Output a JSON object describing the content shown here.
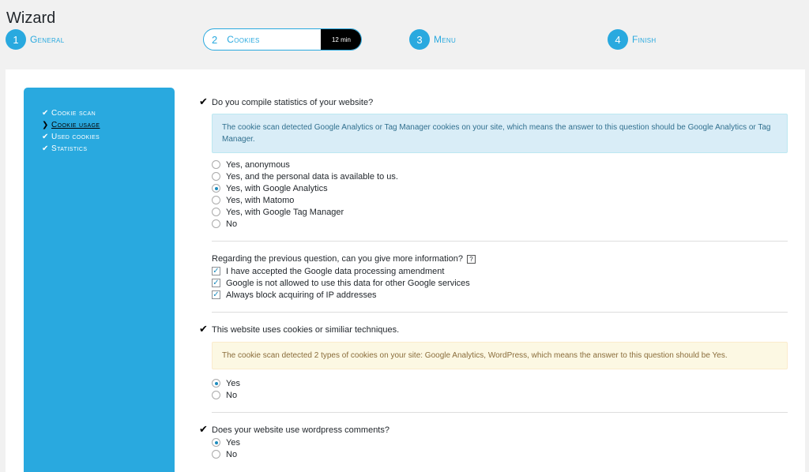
{
  "page": {
    "title": "Wizard"
  },
  "steps": [
    {
      "num": "1",
      "label": "General"
    },
    {
      "num": "2",
      "label": "Cookies",
      "time": "12 min"
    },
    {
      "num": "3",
      "label": "Menu"
    },
    {
      "num": "4",
      "label": "Finish"
    }
  ],
  "sidebar": {
    "items": [
      {
        "label": "Cookie scan",
        "icon": "✔"
      },
      {
        "label": "Cookie usage",
        "icon": "❯"
      },
      {
        "label": "Used cookies",
        "icon": "✔"
      },
      {
        "label": "Statistics",
        "icon": "✔"
      }
    ]
  },
  "q1": {
    "question": "Do you compile statistics of your website?",
    "notice": "The cookie scan detected Google Analytics or Tag Manager cookies on your site, which means the answer to this question should be Google Analytics or Tag Manager.",
    "options": [
      "Yes, anonymous",
      "Yes, and the personal data is available to us.",
      "Yes, with Google Analytics",
      "Yes, with Matomo",
      "Yes, with Google Tag Manager",
      "No"
    ],
    "selected_index": 2
  },
  "q2": {
    "question": "Regarding the previous question, can you give more information?",
    "help": "?",
    "options": [
      "I have accepted the Google data processing amendment",
      "Google is not allowed to use this data for other Google services",
      "Always block acquiring of IP addresses"
    ]
  },
  "q3": {
    "question": "This website uses cookies or similiar techniques.",
    "notice": "The cookie scan detected 2 types of cookies on your site: Google Analytics, WordPress, which means the answer to this question should be Yes.",
    "options": [
      "Yes",
      "No"
    ],
    "selected_index": 0
  },
  "q4": {
    "question": "Does your website use wordpress comments?",
    "options": [
      "Yes",
      "No"
    ],
    "selected_index": 0
  },
  "icons": {
    "answered": "check-icon",
    "current": "chevron-right-icon"
  },
  "colors": {
    "accent": "#29a9df",
    "info_bg": "#d9edf7",
    "warn_bg": "#fcf8e3"
  }
}
